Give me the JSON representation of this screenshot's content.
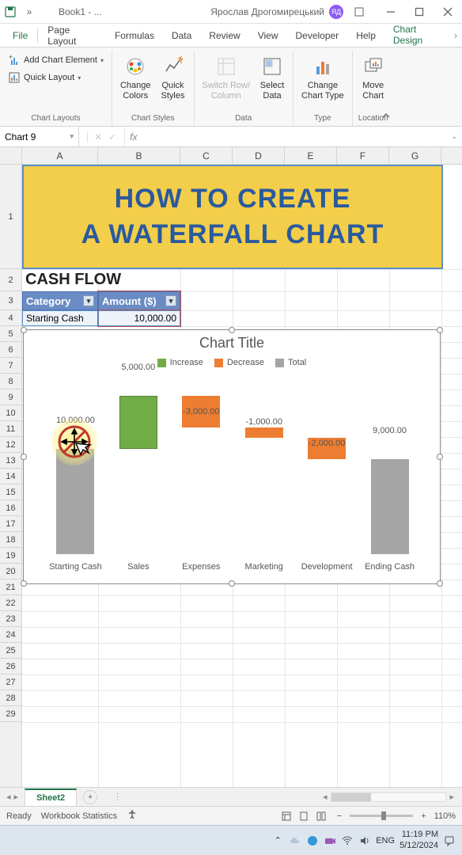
{
  "titlebar": {
    "doc_name": "Book1 - ...",
    "user_name": "Ярослав Дрогомирецький",
    "user_initials": "ЯД"
  },
  "tabs": {
    "file": "File",
    "page_layout": "Page Layout",
    "formulas": "Formulas",
    "data": "Data",
    "review": "Review",
    "view": "View",
    "developer": "Developer",
    "help": "Help",
    "chart_design": "Chart Design"
  },
  "ribbon": {
    "add_chart_element": "Add Chart Element",
    "quick_layout": "Quick Layout",
    "group_chart_layouts": "Chart Layouts",
    "change_colors": "Change\nColors",
    "quick_styles": "Quick\nStyles",
    "group_chart_styles": "Chart Styles",
    "switch_row_col": "Switch Row/\nColumn",
    "select_data": "Select\nData",
    "group_data": "Data",
    "change_chart_type": "Change\nChart Type",
    "group_type": "Type",
    "move_chart": "Move\nChart",
    "group_location": "Location"
  },
  "formula_bar": {
    "name_box": "Chart 9",
    "fx": "fx"
  },
  "columns": [
    "A",
    "B",
    "C",
    "D",
    "E",
    "F",
    "G"
  ],
  "worksheet": {
    "banner_line1": "HOW TO CREATE",
    "banner_line2": "A WATERFALL CHART",
    "cash_flow": "CASH FLOW",
    "hdr_category": "Category",
    "hdr_amount": "Amount ($)",
    "starting_cash_label": "Starting Cash",
    "starting_cash_value": "10,000.00"
  },
  "chart": {
    "title": "Chart Title",
    "legend": {
      "increase": "Increase",
      "decrease": "Decrease",
      "total": "Total"
    },
    "colors": {
      "increase": "#70ad47",
      "decrease": "#ed7d31",
      "total": "#a5a5a5"
    }
  },
  "chart_data": {
    "type": "waterfall",
    "categories": [
      "Starting Cash",
      "Sales",
      "Expenses",
      "Marketing",
      "Development",
      "Ending Cash"
    ],
    "values": [
      10000,
      5000,
      -3000,
      -1000,
      -2000,
      9000
    ],
    "labels": [
      "10,000.00",
      "5,000.00",
      "-3,000.00",
      "-1,000.00",
      "-2,000.00",
      "9,000.00"
    ],
    "kinds": [
      "total",
      "increase",
      "decrease",
      "decrease",
      "decrease",
      "total"
    ],
    "title": "Chart Title",
    "xlabel": "",
    "ylabel": "",
    "ylim": [
      0,
      15000
    ]
  },
  "sheet_tabs": {
    "active": "Sheet2"
  },
  "status_bar": {
    "ready": "Ready",
    "workbook_stats": "Workbook Statistics",
    "zoom": "110%"
  },
  "taskbar": {
    "lang": "ENG",
    "time": "11:19 PM",
    "date": "5/12/2024"
  }
}
